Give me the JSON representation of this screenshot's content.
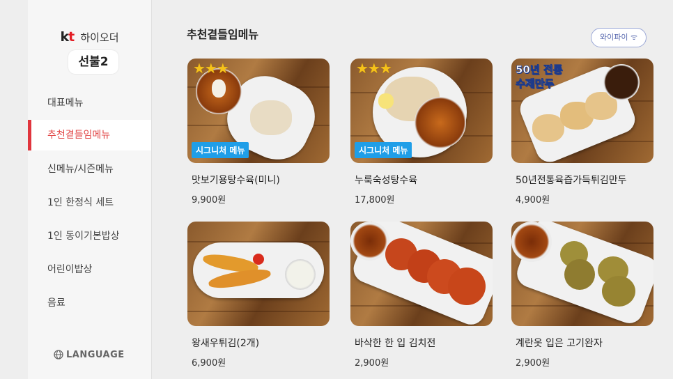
{
  "sidebar": {
    "brand_kt": "kt",
    "brand_name": "하이오더",
    "store": "선불2",
    "categories": [
      {
        "label": "대표메뉴",
        "active": false
      },
      {
        "label": "추천곁들임메뉴",
        "active": true
      },
      {
        "label": "신메뉴/시즌메뉴",
        "active": false
      },
      {
        "label": "1인 한정식 세트",
        "active": false
      },
      {
        "label": "1인 동이기본밥상",
        "active": false
      },
      {
        "label": "어린이밥상",
        "active": false
      },
      {
        "label": "음료",
        "active": false
      }
    ],
    "language": "LANGUAGE"
  },
  "main": {
    "title": "추천곁들임메뉴",
    "wifi": "와이파이 ᯤ",
    "items": [
      {
        "name": "맛보기용탕수육(미니)",
        "price": "9,900원",
        "badge": "시그니처 메뉴",
        "stars": "★★★",
        "promo": ""
      },
      {
        "name": "누룩숙성탕수육",
        "price": "17,800원",
        "badge": "시그니처 메뉴",
        "stars": "★★★",
        "promo": ""
      },
      {
        "name": "50년전통육즙가득튀김만두",
        "price": "4,900원",
        "badge": "",
        "stars": "",
        "promo": "50년 전통\n수제만두"
      },
      {
        "name": "왕새우튀김(2개)",
        "price": "6,900원",
        "badge": "",
        "stars": "",
        "promo": ""
      },
      {
        "name": "바삭한 한 입 김치전",
        "price": "2,900원",
        "badge": "",
        "stars": "",
        "promo": ""
      },
      {
        "name": "계란옷 입은 고기완자",
        "price": "2,900원",
        "badge": "",
        "stars": "",
        "promo": ""
      }
    ]
  },
  "colors": {
    "accent": "#e0353d",
    "badge": "#1f9ee8",
    "star": "#f6c21a"
  }
}
